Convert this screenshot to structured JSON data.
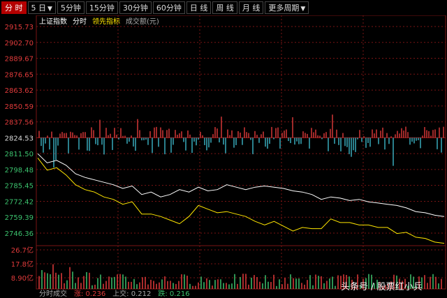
{
  "toolbar": {
    "tabs": [
      {
        "label": "分 时",
        "active": true
      },
      {
        "label": "5 日",
        "dropdown": true
      },
      {
        "label": "5分钟"
      },
      {
        "label": "15分钟"
      },
      {
        "label": "30分钟"
      },
      {
        "label": "60分钟"
      },
      {
        "label": "日 线"
      },
      {
        "label": "周 线"
      },
      {
        "label": "月 线"
      },
      {
        "label": "更多周期",
        "dropdown": true
      }
    ]
  },
  "legend": {
    "index_name": "上证指数",
    "mode": "分时",
    "leading_indicator": "领先指标",
    "volume_label": "成交额(元)"
  },
  "price_axis": [
    "2915.73",
    "2902.70",
    "2889.67",
    "2876.65",
    "2863.62",
    "2850.59",
    "2837.56",
    "2824.53",
    "2811.50",
    "2798.48",
    "2785.45",
    "2772.42",
    "2759.39",
    "2746.36"
  ],
  "base_price": "2824.53",
  "volume_axis": [
    "26.7亿",
    "17.8亿",
    "8.90亿"
  ],
  "bottom_info": {
    "a": "分时成交",
    "b": "涨: 0.236",
    "c": "上交: 0.212",
    "d": "跌: 0.216"
  },
  "watermark": "头条号 / 股票红小兵",
  "colors": {
    "price_line": "#ffffff",
    "avg_line": "#ffe600",
    "up": "#e23b3b",
    "down": "#3cb6c8",
    "grid": "#7a1414"
  },
  "chart_data": {
    "type": "line",
    "title": "",
    "ylim": [
      2746.36,
      2915.73
    ],
    "series": [
      {
        "name": "",
        "values": [
          2811.5,
          2804,
          2806,
          2802,
          2795,
          2792,
          2790,
          2788,
          2786,
          2783,
          2785,
          2778,
          2780,
          2776,
          2778,
          2782,
          2780,
          2784,
          2781,
          2782,
          2786,
          2784,
          2782,
          2784,
          2785,
          2784,
          2783,
          2781,
          2780,
          2778,
          2774,
          2776,
          2775,
          2773,
          2774,
          2772,
          2771,
          2770,
          2769,
          2767,
          2764,
          2763,
          2761,
          2760
        ]
      },
      {
        "name": "",
        "values": [
          2808,
          2798,
          2800,
          2794,
          2786,
          2782,
          2780,
          2776,
          2774,
          2770,
          2772,
          2762,
          2762,
          2760,
          2757,
          2754,
          2760,
          2769,
          2766,
          2763,
          2764,
          2762,
          2760,
          2756,
          2753,
          2756,
          2752,
          2748,
          2751,
          2750,
          2750,
          2758,
          2755,
          2755,
          2753,
          2753,
          2751,
          2751,
          2746,
          2747,
          2743,
          2742,
          2739,
          2738
        ]
      }
    ]
  }
}
